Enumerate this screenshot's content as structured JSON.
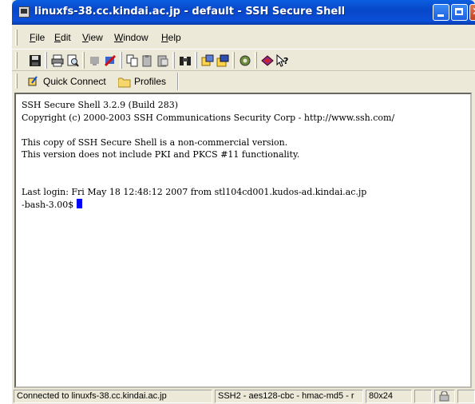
{
  "window": {
    "title": "linuxfs-38.cc.kindai.ac.jp - default - SSH Secure Shell"
  },
  "menu": {
    "items": [
      {
        "first": "F",
        "rest": "ile"
      },
      {
        "first": "E",
        "rest": "dit"
      },
      {
        "first": "V",
        "rest": "iew"
      },
      {
        "first": "W",
        "rest": "indow"
      },
      {
        "first": "H",
        "rest": "elp"
      }
    ]
  },
  "toolbar": {
    "icons": [
      "save-icon",
      "print-icon",
      "print-preview-icon",
      "connect-icon",
      "disconnect-icon",
      "copy-icon",
      "paste-icon",
      "paste-alt-icon",
      "find-icon",
      "file-transfer-icon",
      "new-terminal-icon",
      "settings-icon",
      "help-book-icon",
      "context-help-icon"
    ]
  },
  "profilebar": {
    "quick_connect": "Quick Connect",
    "profiles": "Profiles"
  },
  "terminal": {
    "lines": [
      "SSH Secure Shell 3.2.9 (Build 283)",
      "Copyright (c) 2000-2003 SSH Communications Security Corp - http://www.ssh.com/",
      "",
      "This copy of SSH Secure Shell is a non-commercial version.",
      "This version does not include PKI and PKCS #11 functionality.",
      "",
      "",
      "Last login: Fri May 18 12:48:12 2007 from stl104cd001.kudos-ad.kindai.ac.jp"
    ],
    "prompt": "-bash-3.00$ "
  },
  "status": {
    "connection": "Connected to linuxfs-38.cc.kindai.ac.jp",
    "cipher": "SSH2 - aes128-cbc - hmac-md5 - r",
    "size": "80x24"
  }
}
